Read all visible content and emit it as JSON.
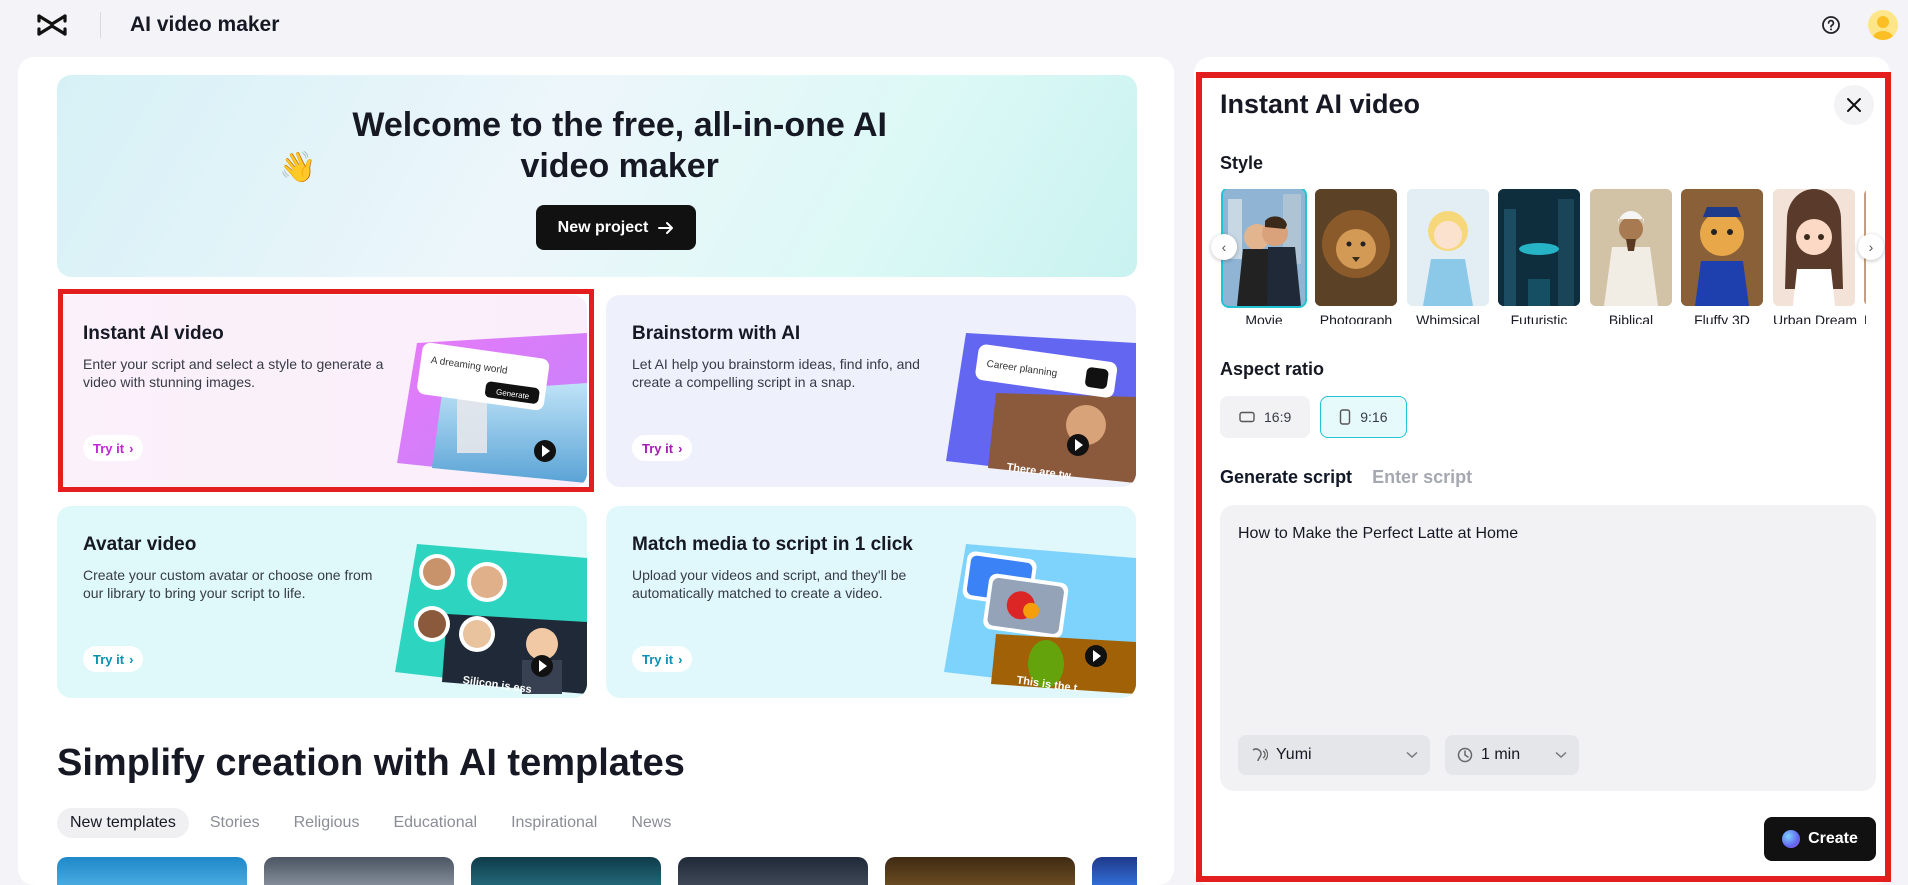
{
  "header": {
    "title": "AI video maker"
  },
  "hero": {
    "emoji": "👋",
    "title": "Welcome to the free, all-in-one AI video maker",
    "button_label": "New project"
  },
  "cards": [
    {
      "title": "Instant AI video",
      "desc": "Enter your script and select a style to generate a video with stunning images.",
      "cta": "Try it",
      "art_text": "A dreaming world",
      "art_button": "Generate"
    },
    {
      "title": "Brainstorm with AI",
      "desc": "Let AI help you brainstorm ideas, find info, and create a compelling script in a snap.",
      "cta": "Try it",
      "art_text": "Career planning",
      "art_caption": "There are tw"
    },
    {
      "title": "Avatar video",
      "desc": "Create your custom avatar or choose one from our library to bring your script to life.",
      "cta": "Try it",
      "art_caption": "Silicon is ess"
    },
    {
      "title": "Match media to script in 1 click",
      "desc": "Upload your videos and script, and they'll be automatically matched to create a video.",
      "cta": "Try it",
      "art_caption": "This is the t"
    }
  ],
  "templates": {
    "title": "Simplify creation with AI templates",
    "tabs": [
      "New templates",
      "Stories",
      "Religious",
      "Educational",
      "Inspirational",
      "News"
    ]
  },
  "panel": {
    "title": "Instant AI video",
    "style_label": "Style",
    "styles": [
      "Movie",
      "Photograph",
      "Whimsical",
      "Futuristic",
      "Biblical",
      "Fluffy 3D",
      "Urban Dream",
      "D"
    ],
    "aspect_label": "Aspect ratio",
    "ratios": [
      "16:9",
      "9:16"
    ],
    "script_tabs": {
      "active": "Generate script",
      "inactive": "Enter script"
    },
    "script_text": "How to Make the Perfect Latte at Home",
    "voice": "Yumi",
    "duration": "1 min",
    "create_label": "Create"
  }
}
